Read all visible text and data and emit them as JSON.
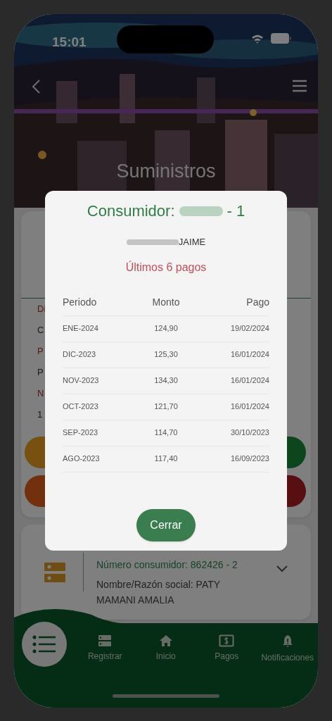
{
  "status_bar": {
    "time": "15:01"
  },
  "header": {
    "title": "Suministros"
  },
  "card_behind": {
    "fragments": [
      {
        "text": "Di",
        "kind": "label"
      },
      {
        "text": "C",
        "kind": "value"
      },
      {
        "text": "P",
        "kind": "label"
      },
      {
        "text": "P",
        "kind": "value"
      },
      {
        "text": "N",
        "kind": "label"
      },
      {
        "text": "1",
        "kind": "value"
      }
    ]
  },
  "card_second": {
    "consumer_number": "Número consumidor: 862426 - 2",
    "name": "Nombre/Razón social: PATY MAMANI AMALIA"
  },
  "modal": {
    "title": "Consumidor:",
    "title_suffix": "- 1",
    "name": "JAIME",
    "subtitle": "Últimos 6 pagos",
    "columns": [
      "Periodo",
      "Monto",
      "Pago"
    ],
    "rows": [
      {
        "period": "ENE-2024",
        "amount": "124,90",
        "paid": "19/02/2024"
      },
      {
        "period": "DIC-2023",
        "amount": "125,30",
        "paid": "16/01/2024"
      },
      {
        "period": "NOV-2023",
        "amount": "134,30",
        "paid": "16/01/2024"
      },
      {
        "period": "OCT-2023",
        "amount": "121,70",
        "paid": "16/01/2024"
      },
      {
        "period": "SEP-2023",
        "amount": "114,70",
        "paid": "30/10/2023"
      },
      {
        "period": "AGO-2023",
        "amount": "117,40",
        "paid": "16/09/2023"
      }
    ],
    "close_button": "Cerrar"
  },
  "nav": [
    {
      "label": "Registrar",
      "kind": "register"
    },
    {
      "label": "Inicio",
      "kind": "home"
    },
    {
      "label": "Pagos",
      "kind": "payments"
    },
    {
      "label": "Notificaciones",
      "kind": "notifications"
    }
  ]
}
